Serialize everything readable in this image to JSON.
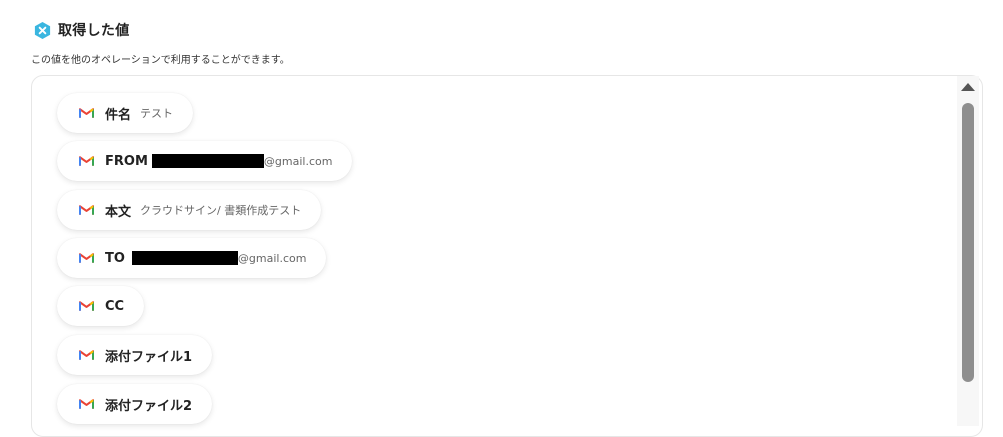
{
  "header": {
    "icon": "yoom-x-icon",
    "title": "取得した値",
    "subtitle": "この値を他のオペレーションで利用することができます。"
  },
  "colors": {
    "header_icon": "#3ab6e0",
    "gmail_red": "#ea4335",
    "gmail_blue": "#4285f4",
    "gmail_green": "#34a853",
    "gmail_yellow": "#fbbc04"
  },
  "values": [
    {
      "icon": "gmail-icon",
      "label": "件名",
      "value": "テスト",
      "redacted": false
    },
    {
      "icon": "gmail-icon",
      "label": "FROM",
      "value": "@gmail.com",
      "redacted": true
    },
    {
      "icon": "gmail-icon",
      "label": "本文",
      "value": "クラウドサイン/ 書類作成テスト",
      "redacted": false
    },
    {
      "icon": "gmail-icon",
      "label": "TO",
      "value": "@gmail.com",
      "redacted": true
    },
    {
      "icon": "gmail-icon",
      "label": "CC",
      "value": "",
      "redacted": false
    },
    {
      "icon": "gmail-icon",
      "label": "添付ファイル1",
      "value": "",
      "redacted": false
    },
    {
      "icon": "gmail-icon",
      "label": "添付ファイル2",
      "value": "",
      "redacted": false
    }
  ]
}
